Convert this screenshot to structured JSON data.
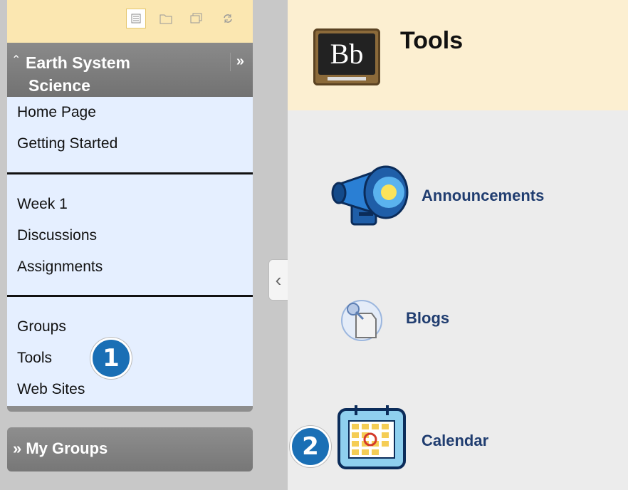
{
  "sidebar": {
    "course_title_line1": "Earth System",
    "course_title_line2": "Science",
    "sections": [
      [
        "Home Page",
        "Getting Started"
      ],
      [
        "Week 1",
        "Discussions",
        "Assignments"
      ],
      [
        "Groups",
        "Tools",
        "Web Sites"
      ]
    ],
    "my_groups": "My Groups"
  },
  "page": {
    "title": "Tools",
    "logo_text": "Bb",
    "tools": [
      {
        "label": "Announcements",
        "icon": "megaphone-icon"
      },
      {
        "label": "Blogs",
        "icon": "blog-pin-icon"
      },
      {
        "label": "Calendar",
        "icon": "calendar-icon"
      }
    ]
  },
  "callouts": [
    "1",
    "2"
  ],
  "colors": {
    "accent": "#1a6fb5",
    "toolbar": "#fbe7b1",
    "header": "#fcefd1",
    "menu_bg": "#e5efff",
    "link": "#203d70"
  }
}
